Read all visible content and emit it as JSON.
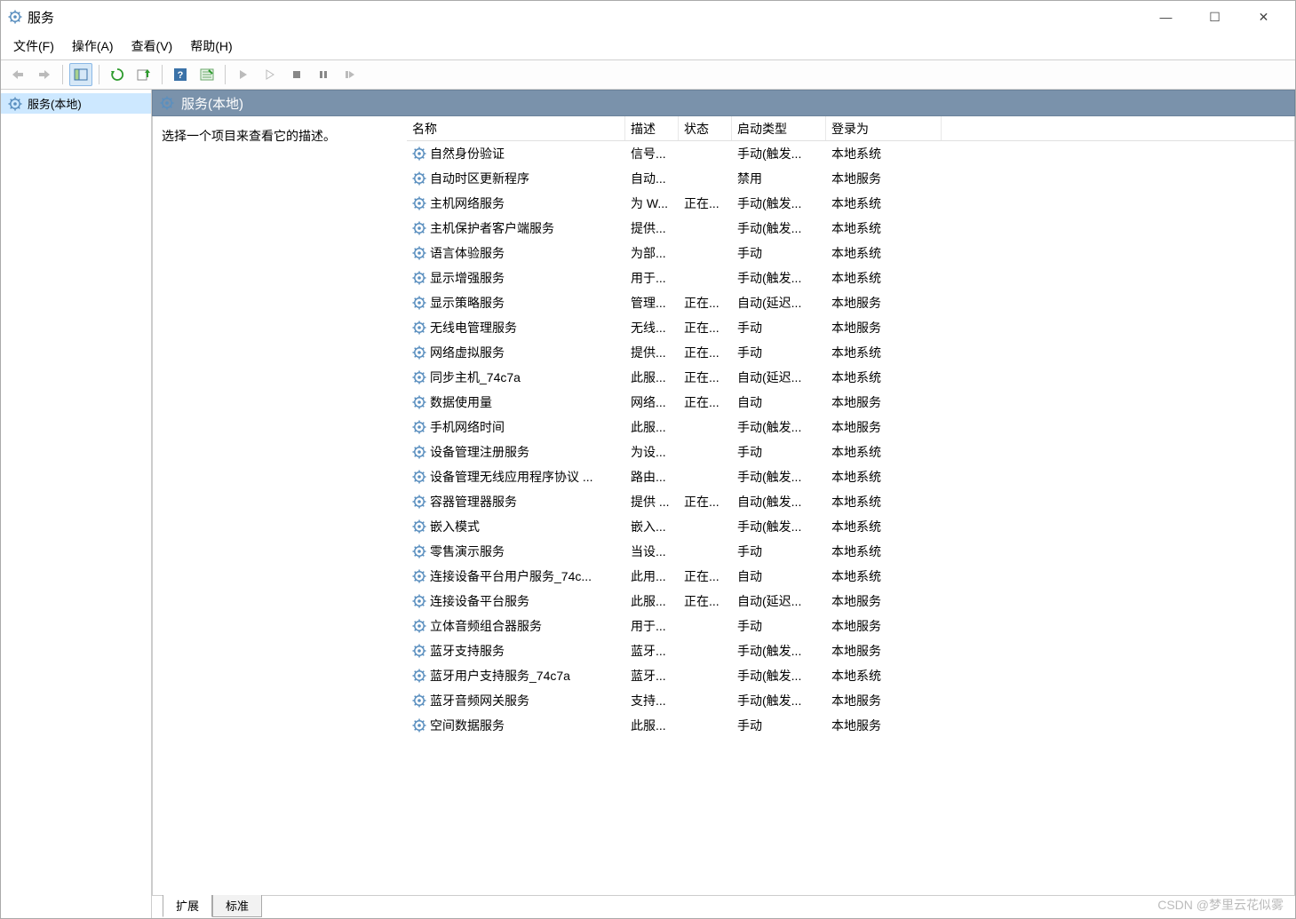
{
  "window": {
    "title": "服务"
  },
  "menu": {
    "file": "文件(F)",
    "action": "操作(A)",
    "view": "查看(V)",
    "help": "帮助(H)"
  },
  "tree": {
    "root": "服务(本地)"
  },
  "pane": {
    "header": "服务(本地)",
    "desc_prompt": "选择一个项目来查看它的描述。"
  },
  "columns": {
    "name": "名称",
    "desc": "描述",
    "state": "状态",
    "start": "启动类型",
    "logon": "登录为"
  },
  "tabs": {
    "extended": "扩展",
    "standard": "标准"
  },
  "watermark": "CSDN @梦里云花似雾",
  "services": [
    {
      "name": "自然身份验证",
      "desc": "信号...",
      "state": "",
      "start": "手动(触发...",
      "logon": "本地系统"
    },
    {
      "name": "自动时区更新程序",
      "desc": "自动...",
      "state": "",
      "start": "禁用",
      "logon": "本地服务"
    },
    {
      "name": "主机网络服务",
      "desc": "为 W...",
      "state": "正在...",
      "start": "手动(触发...",
      "logon": "本地系统"
    },
    {
      "name": "主机保护者客户端服务",
      "desc": "提供...",
      "state": "",
      "start": "手动(触发...",
      "logon": "本地系统"
    },
    {
      "name": "语言体验服务",
      "desc": "为部...",
      "state": "",
      "start": "手动",
      "logon": "本地系统"
    },
    {
      "name": "显示增强服务",
      "desc": "用于...",
      "state": "",
      "start": "手动(触发...",
      "logon": "本地系统"
    },
    {
      "name": "显示策略服务",
      "desc": "管理...",
      "state": "正在...",
      "start": "自动(延迟...",
      "logon": "本地服务"
    },
    {
      "name": "无线电管理服务",
      "desc": "无线...",
      "state": "正在...",
      "start": "手动",
      "logon": "本地服务"
    },
    {
      "name": "网络虚拟服务",
      "desc": "提供...",
      "state": "正在...",
      "start": "手动",
      "logon": "本地系统"
    },
    {
      "name": "同步主机_74c7a",
      "desc": "此服...",
      "state": "正在...",
      "start": "自动(延迟...",
      "logon": "本地系统"
    },
    {
      "name": "数据使用量",
      "desc": "网络...",
      "state": "正在...",
      "start": "自动",
      "logon": "本地服务"
    },
    {
      "name": "手机网络时间",
      "desc": "此服...",
      "state": "",
      "start": "手动(触发...",
      "logon": "本地服务"
    },
    {
      "name": "设备管理注册服务",
      "desc": "为设...",
      "state": "",
      "start": "手动",
      "logon": "本地系统"
    },
    {
      "name": "设备管理无线应用程序协议 ...",
      "desc": "路由...",
      "state": "",
      "start": "手动(触发...",
      "logon": "本地系统"
    },
    {
      "name": "容器管理器服务",
      "desc": "提供 ...",
      "state": "正在...",
      "start": "自动(触发...",
      "logon": "本地系统"
    },
    {
      "name": "嵌入模式",
      "desc": "嵌入...",
      "state": "",
      "start": "手动(触发...",
      "logon": "本地系统"
    },
    {
      "name": "零售演示服务",
      "desc": "当设...",
      "state": "",
      "start": "手动",
      "logon": "本地系统"
    },
    {
      "name": "连接设备平台用户服务_74c...",
      "desc": "此用...",
      "state": "正在...",
      "start": "自动",
      "logon": "本地系统"
    },
    {
      "name": "连接设备平台服务",
      "desc": "此服...",
      "state": "正在...",
      "start": "自动(延迟...",
      "logon": "本地服务"
    },
    {
      "name": "立体音频组合器服务",
      "desc": "用于...",
      "state": "",
      "start": "手动",
      "logon": "本地服务"
    },
    {
      "name": "蓝牙支持服务",
      "desc": "蓝牙...",
      "state": "",
      "start": "手动(触发...",
      "logon": "本地服务"
    },
    {
      "name": "蓝牙用户支持服务_74c7a",
      "desc": "蓝牙...",
      "state": "",
      "start": "手动(触发...",
      "logon": "本地系统"
    },
    {
      "name": "蓝牙音频网关服务",
      "desc": "支持...",
      "state": "",
      "start": "手动(触发...",
      "logon": "本地服务"
    },
    {
      "name": "空间数据服务",
      "desc": "此服...",
      "state": "",
      "start": "手动",
      "logon": "本地服务"
    }
  ]
}
